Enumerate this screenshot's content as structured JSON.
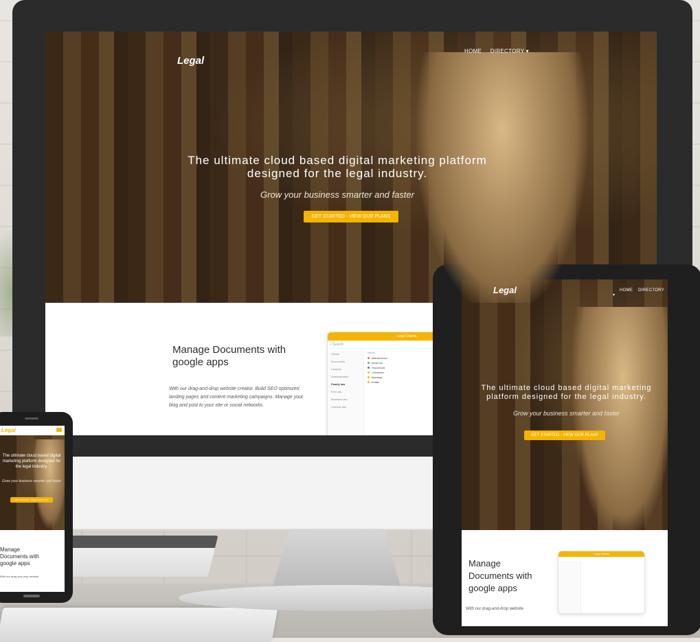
{
  "brand": "Legal",
  "nav": {
    "home": "HOME",
    "directory": "DIRECTORY"
  },
  "hero": {
    "title": "The ultimate cloud based digital marketing platform designed for the legal industry.",
    "subtitle": "Grow your business smarter and faster",
    "cta": "GET STARTED - VIEW OUR PLANS"
  },
  "feature": {
    "heading_desktop": "Manage Documents with google apps",
    "heading_tablet": "Manage Documents with google apps",
    "heading_phone": "Manage Documents with google apps",
    "text": "With our drag-and-drop website creator. Build SEO optimized landing pages and content marketing campaigns. Manage your blog and post to your site or social networks.",
    "text_tablet": "With our drag-and-drop website",
    "text_phone": "With our drag-and-drop website"
  },
  "dashboard": {
    "title": "Legal Clients",
    "search": "Search",
    "column": "Name",
    "sidebar": [
      "Clients",
      "Documents",
      "Lawyers",
      "Administration",
      "Family law",
      "Firm law",
      "Business law",
      "Criminal law"
    ],
    "rows": [
      {
        "label": "Maintenance",
        "color": "#f06a3a"
      },
      {
        "label": "Revenue",
        "color": "#39b1e8"
      },
      {
        "label": "Household",
        "color": "#3a6de8"
      },
      {
        "label": "Clienteles",
        "color": "#f5b400"
      },
      {
        "label": "Marriage",
        "color": "#f5b400"
      },
      {
        "label": "Estate",
        "color": "#f5b400"
      }
    ]
  },
  "colors": {
    "accent": "#f5b400",
    "frame": "#2b2b2b"
  }
}
